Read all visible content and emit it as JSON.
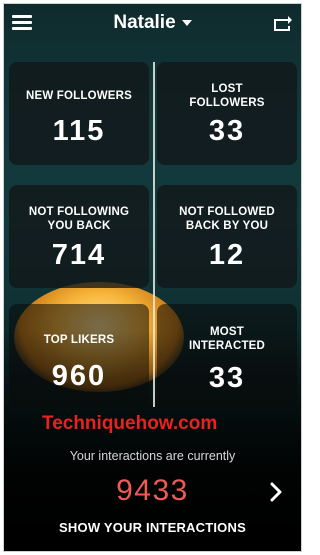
{
  "header": {
    "account_name": "Natalie",
    "icons": {
      "menu": "hamburger-icon",
      "dropdown": "caret-down-icon",
      "switch": "switch-account-icon"
    }
  },
  "stats": {
    "new_followers": {
      "label": "NEW FOLLOWERS",
      "value": "115"
    },
    "lost_followers": {
      "label": "LOST\nFOLLOWERS",
      "value": "33"
    },
    "not_following_back": {
      "label": "NOT FOLLOWING\nYOU BACK",
      "value": "714"
    },
    "not_followed_back": {
      "label": "NOT FOLLOWED\nBACK BY YOU",
      "value": "12"
    },
    "top_likers": {
      "label": "TOP LIKERS",
      "value": "960"
    },
    "most_interacted": {
      "label": "MOST\nINTERACTED",
      "value": "33"
    }
  },
  "watermark": "Techniquehow.com",
  "interactions": {
    "subtitle": "Your interactions are currently",
    "count": "9433",
    "cta_label": "SHOW YOUR INTERACTIONS"
  },
  "colors": {
    "accent_red": "#ee5b55",
    "watermark_red": "#e8231f",
    "tile_bg": "#121618"
  }
}
